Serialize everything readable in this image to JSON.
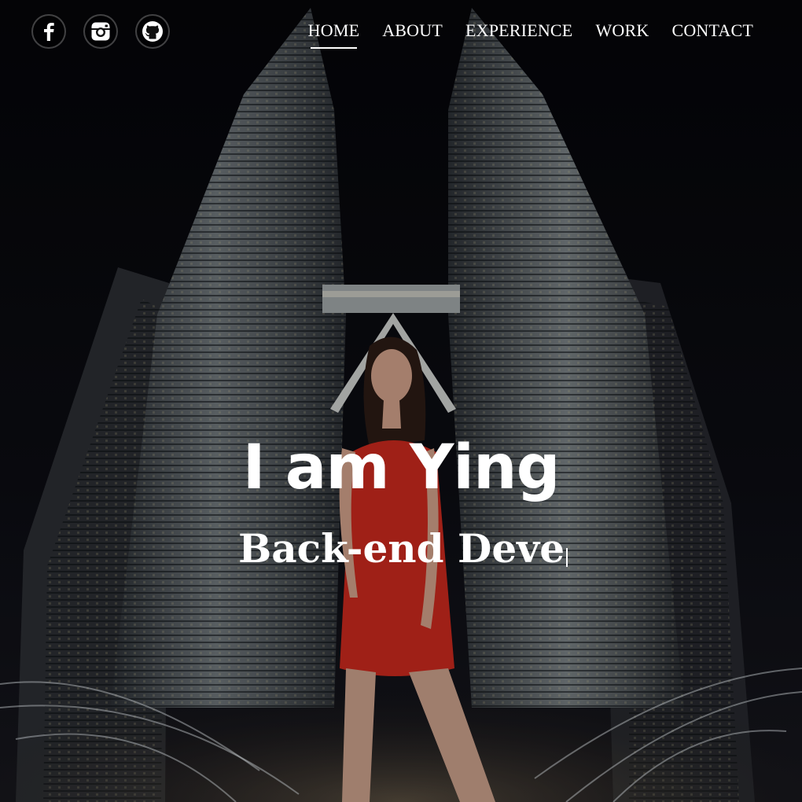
{
  "social": {
    "items": [
      {
        "name": "facebook",
        "icon": "facebook-icon"
      },
      {
        "name": "instagram",
        "icon": "instagram-icon"
      },
      {
        "name": "github",
        "icon": "github-icon"
      }
    ]
  },
  "nav": {
    "items": [
      "HOME",
      "ABOUT",
      "EXPERIENCE",
      "WORK",
      "CONTACT"
    ],
    "active": "HOME"
  },
  "hero": {
    "headline": "I am Ying",
    "typed_text": "Back-end Deve",
    "background_image": "night-view-of-twin-towers-with-woman-in-red-dress"
  },
  "colors": {
    "text": "#ffffff",
    "background": "#07080c",
    "dress": "#c2281d"
  }
}
